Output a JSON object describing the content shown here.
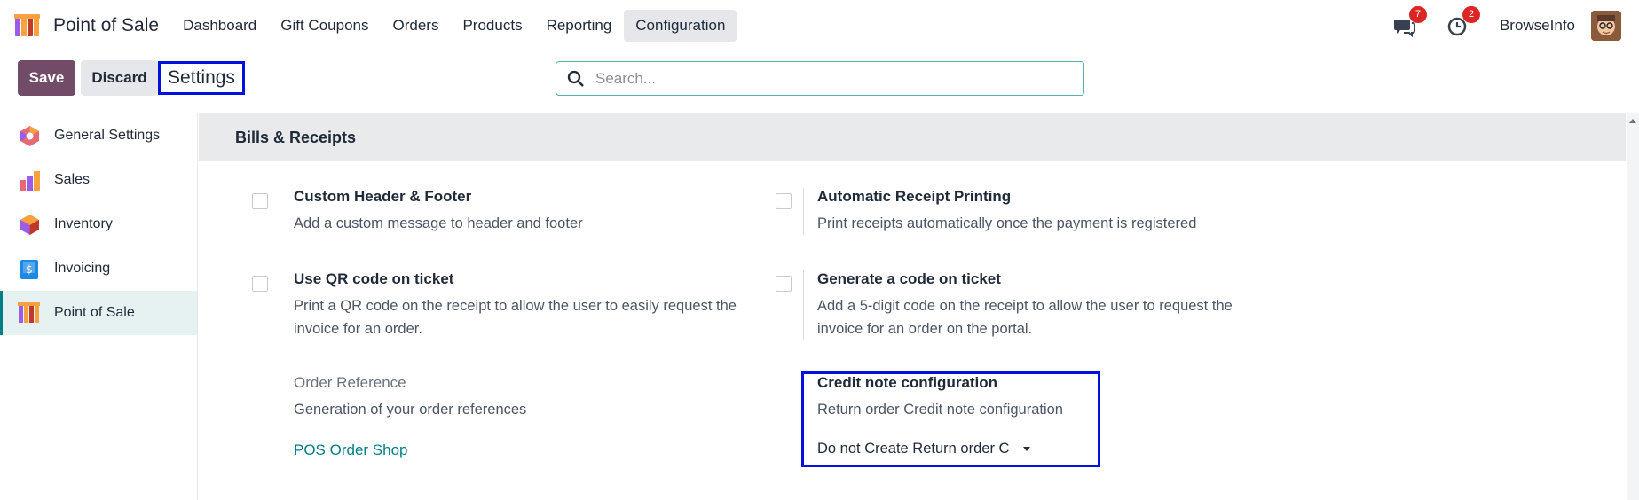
{
  "navbar": {
    "app_name": "Point of Sale",
    "menu": [
      "Dashboard",
      "Gift Coupons",
      "Orders",
      "Products",
      "Reporting",
      "Configuration"
    ],
    "active_menu": "Configuration",
    "messages_badge": "7",
    "activities_badge": "2",
    "user_name": "BrowseInfo"
  },
  "control_panel": {
    "save_label": "Save",
    "discard_label": "Discard",
    "breadcrumb": "Settings",
    "search_placeholder": "Search..."
  },
  "sidebar": {
    "items": [
      {
        "label": "General Settings",
        "icon": "general-settings-icon"
      },
      {
        "label": "Sales",
        "icon": "sales-app-icon"
      },
      {
        "label": "Inventory",
        "icon": "inventory-app-icon"
      },
      {
        "label": "Invoicing",
        "icon": "invoicing-app-icon"
      },
      {
        "label": "Point of Sale",
        "icon": "pos-app-icon"
      }
    ],
    "active": "Point of Sale"
  },
  "section": {
    "title": "Bills & Receipts",
    "settings": {
      "custom_header": {
        "title": "Custom Header & Footer",
        "desc": "Add a custom message to header and footer",
        "checked": false
      },
      "auto_receipt": {
        "title": "Automatic Receipt Printing",
        "desc": "Print receipts automatically once the payment is registered",
        "checked": false
      },
      "qr_code": {
        "title": "Use QR code on ticket",
        "desc": "Print a QR code on the receipt to allow the user to easily request the invoice for an order.",
        "checked": false
      },
      "gen_code": {
        "title": "Generate a code on ticket",
        "desc": "Add a 5-digit code on the receipt to allow the user to request the invoice for an order on the portal.",
        "checked": false
      },
      "order_ref": {
        "title": "Order Reference",
        "desc": "Generation of your order references",
        "link": "POS Order Shop"
      },
      "credit_note": {
        "title": "Credit note configuration",
        "desc": "Return order Credit note configuration",
        "selected": "Do not Create Return order C"
      }
    }
  },
  "colors": {
    "brand": "#714b67",
    "teal": "#017e84",
    "highlight": "#0011dd",
    "badge": "#dc2626"
  }
}
